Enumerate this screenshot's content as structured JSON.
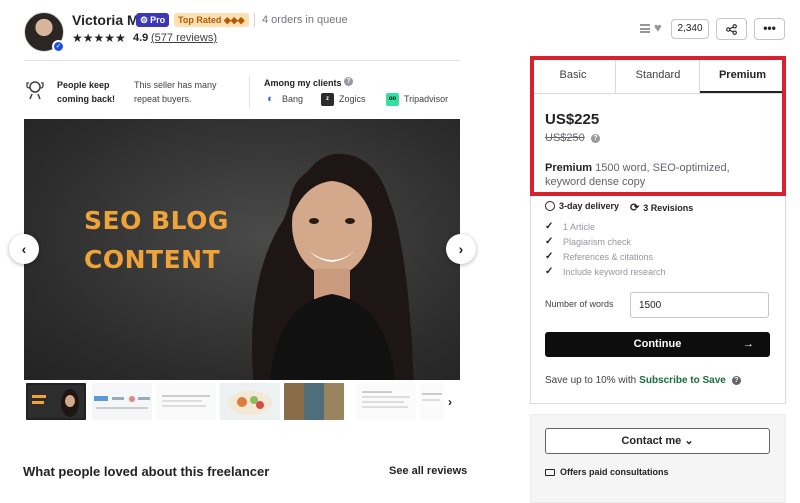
{
  "seller": {
    "name": "Victoria M",
    "pro_label": "Pro",
    "top_rated_label": "Top Rated ◆◆◆",
    "queue": "4 orders in queue",
    "stars": "★★★★★",
    "rating": "4.9",
    "reviews": "(577 reviews)"
  },
  "actions": {
    "likes": "2,340",
    "share_icon": "share-icon",
    "more": "•••"
  },
  "info": {
    "keep_coming": "People keep coming back!",
    "repeat_buyers": "This seller has many repeat buyers.",
    "clients_title": "Among my clients",
    "clients": [
      {
        "name": "Bang"
      },
      {
        "name": "Zogics"
      },
      {
        "name": "Tripadvisor"
      }
    ]
  },
  "gallery": {
    "slide_title_line1": "SEO BLOG",
    "slide_title_line2": "CONTENT",
    "prev": "‹",
    "next": "›",
    "thumb_next": "›"
  },
  "reviews_section": {
    "title": "What people loved about this freelancer",
    "see_all": "See all reviews"
  },
  "package": {
    "tabs": [
      "Basic",
      "Standard",
      "Premium"
    ],
    "active_tab": "Premium",
    "price": "US$225",
    "old_price": "US$250",
    "name": "Premium",
    "description": " 1500 word, SEO-optimized, keyword dense copy",
    "delivery": "3-day delivery",
    "revisions": "3 Revisions",
    "features": [
      "1 Article",
      "Plagiarism check",
      "References & citations",
      "Include keyword research"
    ],
    "words_label": "Number of words",
    "words_value": "1500",
    "continue_label": "Continue",
    "save_prefix": "Save up to 10% with",
    "save_link": "Subscribe to Save"
  },
  "contact": {
    "button_label": "Contact me ⌄",
    "consultations": "Offers paid consultations"
  },
  "colors": {
    "accent_red": "#d9202c",
    "pro_badge": "#3b37b5",
    "subscribe_green": "#1a6b3c",
    "slide_title": "#f0a338"
  }
}
